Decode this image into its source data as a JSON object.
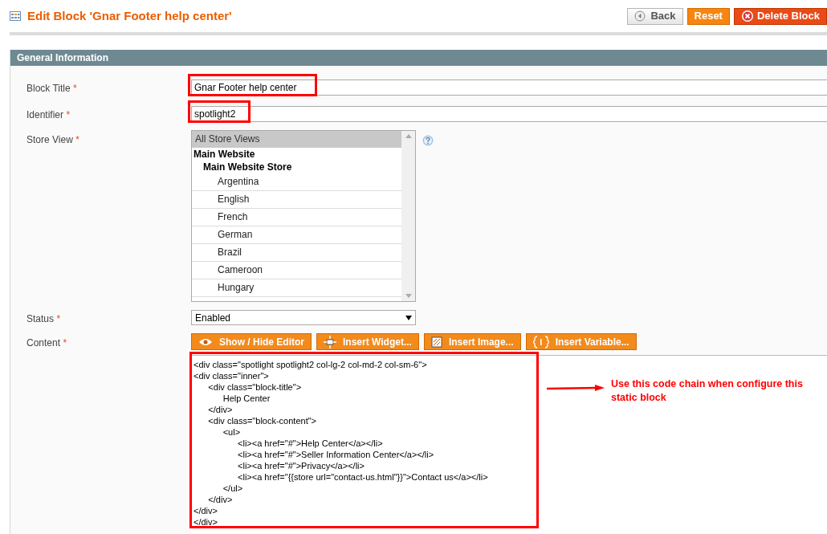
{
  "header": {
    "title": "Edit Block 'Gnar Footer help center'",
    "buttons": [
      {
        "label": "Back",
        "kind": "back"
      },
      {
        "label": "Reset",
        "kind": "reset"
      },
      {
        "label": "Delete Block",
        "kind": "delete"
      }
    ]
  },
  "section": {
    "title": "General Information"
  },
  "fields": [
    {
      "label": "Block Title",
      "required_mark": "*",
      "kind": "text",
      "value": "Gnar Footer help center",
      "highlighted": true
    },
    {
      "label": "Identifier",
      "required_mark": "*",
      "kind": "text",
      "value": "spotlight2",
      "highlighted": true
    },
    {
      "label": "Store View",
      "required_mark": "*",
      "kind": "multiselect",
      "options": [
        {
          "label": "All Store Views",
          "kind": "option",
          "selected": true
        },
        {
          "label": "Main Website",
          "kind": "group",
          "children": [
            {
              "label": "Main Website Store",
              "kind": "group",
              "children": [
                {
                  "label": "Argentina",
                  "kind": "option",
                  "selected": false
                },
                {
                  "label": "English",
                  "kind": "option",
                  "selected": false
                },
                {
                  "label": "French",
                  "kind": "option",
                  "selected": false
                },
                {
                  "label": "German",
                  "kind": "option",
                  "selected": false
                },
                {
                  "label": "Brazil",
                  "kind": "option",
                  "selected": false
                },
                {
                  "label": "Cameroon",
                  "kind": "option",
                  "selected": false
                },
                {
                  "label": "Hungary",
                  "kind": "option",
                  "selected": false
                }
              ]
            }
          ]
        }
      ]
    },
    {
      "label": "Status",
      "required_mark": "*",
      "kind": "select",
      "value": "Enabled"
    },
    {
      "label": "Content",
      "required_mark": "*",
      "kind": "editor",
      "buttons": [
        {
          "label": "Show / Hide Editor",
          "kind": "eye"
        },
        {
          "label": "Insert Widget...",
          "kind": "widget"
        },
        {
          "label": "Insert Image...",
          "kind": "image"
        },
        {
          "label": "Insert Variable...",
          "kind": "variable"
        }
      ],
      "value": "<div class=\"spotlight spotlight2 col-lg-2 col-md-2 col-sm-6\">\n<div class=\"inner\">\n\t<div class=\"block-title\">\n\t\tHelp Center\n\t</div>\n\t<div class=\"block-content\">\n\t\t<ul>\n\t\t\t<li><a href=\"#\">Help Center</a></li>\n\t\t\t<li><a href=\"#\">Seller Information Center</a></li>\n\t\t\t<li><a href=\"#\">Privacy</a></li>\n\t\t\t<li><a href=\"{{store url=\"contact-us.html\"}}\">Contact us</a></li>\n\t\t</ul>\n\t</div>\n</div>\n</div>",
      "highlighted": true,
      "note": "Use this code chain when configure this static block"
    }
  ]
}
